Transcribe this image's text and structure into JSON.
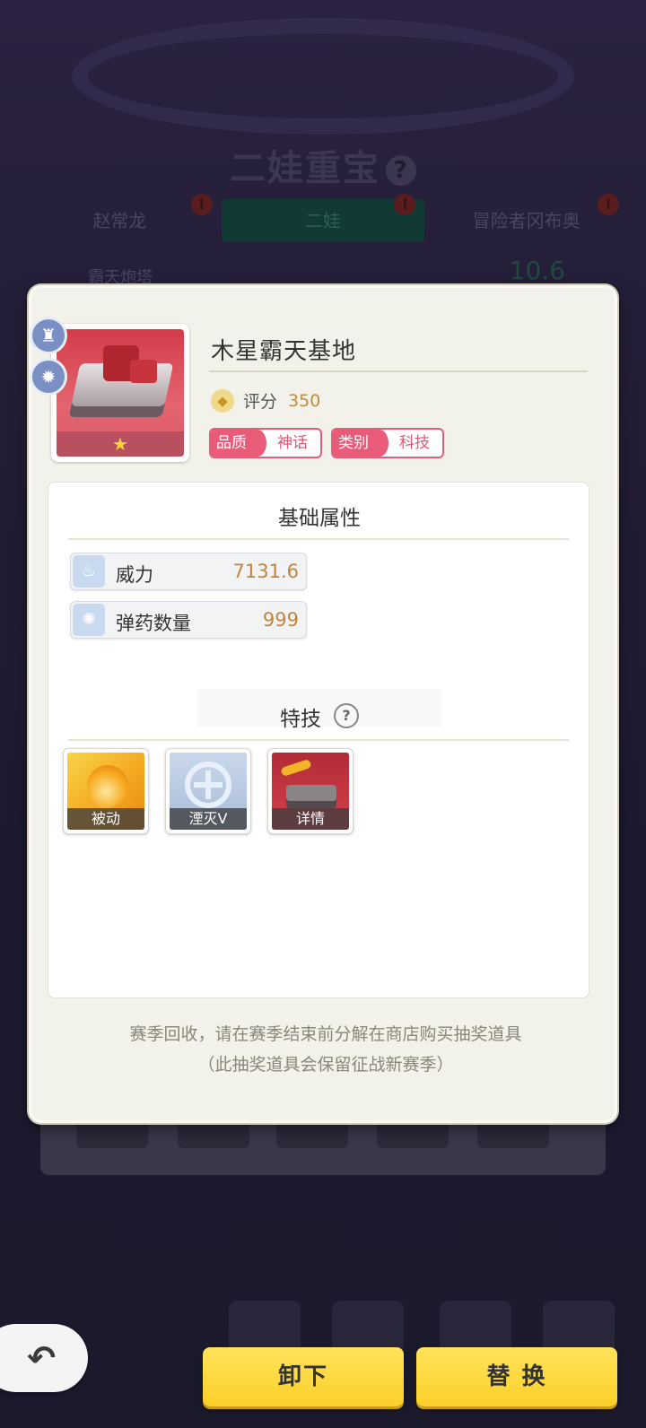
{
  "background": {
    "title": "二娃重宝",
    "title_help": "?",
    "tabs": [
      {
        "label": "赵常龙",
        "badge": "!"
      },
      {
        "label": "二娃",
        "badge": "!"
      },
      {
        "label": "冒险者冈布奥",
        "badge": "!"
      }
    ],
    "row_name": "霸天炮塔",
    "row_value": "10.6"
  },
  "item": {
    "name": "木星霸天基地",
    "star": "★",
    "score_label": "评分",
    "score_value": "350",
    "quality_key": "品质",
    "quality_value": "神话",
    "category_key": "类别",
    "category_value": "科技"
  },
  "attributes": {
    "title": "基础属性",
    "stats": [
      {
        "label": "威力",
        "value": "7131.6",
        "icon": "fire-icon"
      },
      {
        "label": "弹药数量",
        "value": "999",
        "icon": "ammo-icon"
      }
    ]
  },
  "skills": {
    "title": "特技",
    "help": "?",
    "items": [
      {
        "caption": "被动",
        "icon": "flame-icon"
      },
      {
        "caption": "湮灭Ⅴ",
        "icon": "crosshair-icon"
      },
      {
        "caption": "详情",
        "icon": "tank-icon"
      }
    ]
  },
  "footer": {
    "line1": "赛季回收，请在赛季结束前分解在商店购买抽奖道具",
    "line2": "（此抽奖道具会保留征战新赛季）"
  },
  "buttons": {
    "unequip": "卸下",
    "replace": "替 换",
    "back": "↶"
  },
  "colors": {
    "accent_yellow": "#fbcf2a",
    "tag_pink": "#e85c7a",
    "value_orange": "#c5843c"
  }
}
